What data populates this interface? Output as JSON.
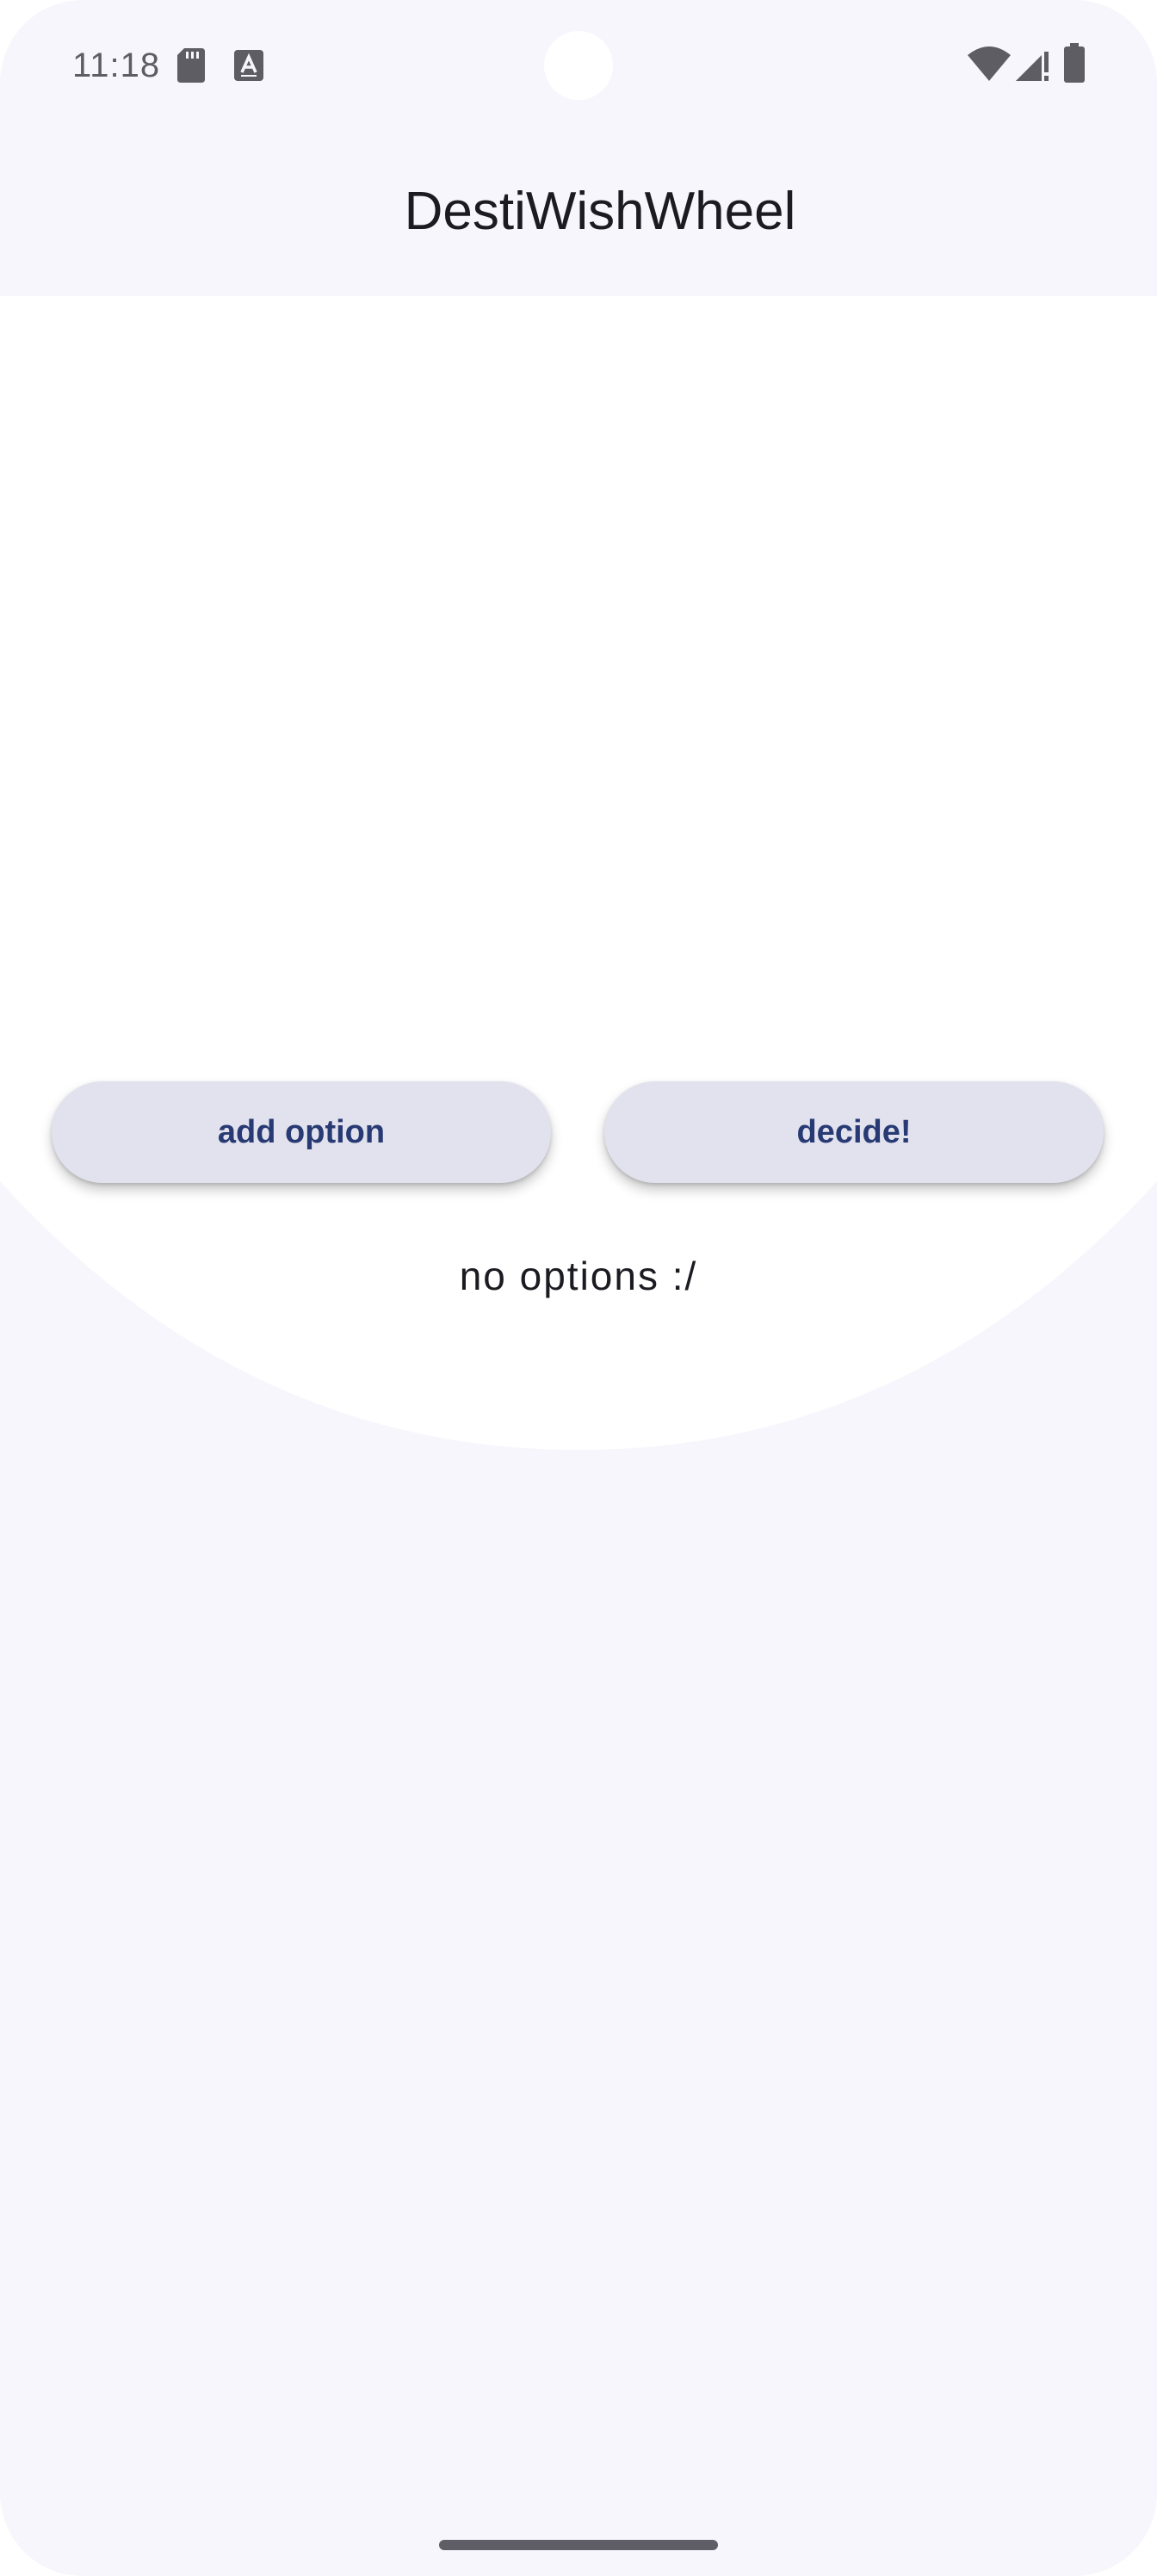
{
  "status_bar": {
    "time": "11:18",
    "icons": [
      "sd-card-icon",
      "a-notification-icon",
      "wifi-icon",
      "signal-icon",
      "battery-icon"
    ]
  },
  "app_bar": {
    "title": "DestiWishWheel"
  },
  "actions": {
    "add_label": "add option",
    "decide_label": "decide!"
  },
  "main": {
    "empty_message": "no options :/"
  },
  "colors": {
    "background": "#f7f6fc",
    "content": "#ffffff",
    "button_bg": "#e2e2ee",
    "button_text": "#283a73",
    "text": "#1b1b21"
  }
}
